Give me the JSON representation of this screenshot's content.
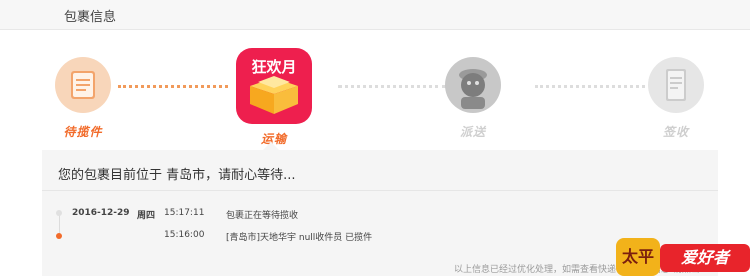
{
  "header": {
    "title": "包裹信息"
  },
  "steps": [
    {
      "label": "待揽件",
      "icon": "notepad-icon",
      "state": "done"
    },
    {
      "label": "运输",
      "icon": "tmall-double11-box-icon",
      "state": "current",
      "badge": "狂欢月"
    },
    {
      "label": "派送",
      "icon": "courier-icon",
      "state": "pending"
    },
    {
      "label": "签收",
      "icon": "receipt-icon",
      "state": "pending"
    }
  ],
  "panel": {
    "status": "您的包裹目前位于 青岛市，请耐心等待..."
  },
  "timeline": [
    {
      "date": "2016-12-29",
      "weekday": "周四",
      "time": "15:17:11",
      "desc": "包裹正在等待揽收"
    },
    {
      "date": "",
      "weekday": "",
      "time": "15:16:00",
      "desc": "[青岛市]天地华宇 null收件员 已揽件"
    }
  ],
  "footer": {
    "note": "以上信息已经过优化处理，如需查看快递公司原始信息 请点击"
  },
  "watermark": {
    "badge": "太平洋",
    "text": "爱好者"
  },
  "colors": {
    "accent": "#f26b2a",
    "tmall_red": "#ee1f4e",
    "inactive": "#cfcfcf"
  }
}
